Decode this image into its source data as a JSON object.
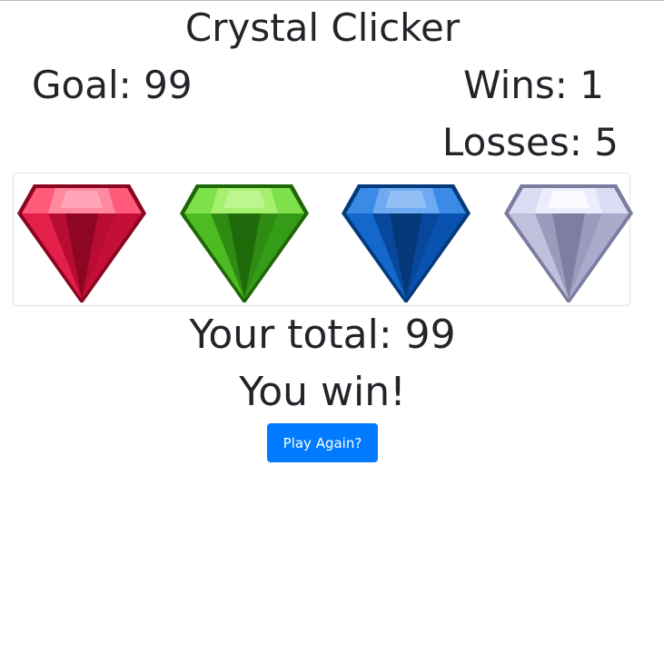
{
  "game": {
    "title": "Crystal Clicker",
    "goal_label": "Goal: ",
    "goal_value": "99",
    "wins_label": "Wins: ",
    "wins_value": "1",
    "losses_label": "Losses: ",
    "losses_value": "5",
    "total_label": "Your total: ",
    "total_value": "99",
    "result_text": "You win!",
    "play_again_label": "Play Again?"
  },
  "crystals": [
    {
      "name": "red-crystal-icon",
      "color": "#d4123a"
    },
    {
      "name": "green-crystal-icon",
      "color": "#3aa81a"
    },
    {
      "name": "blue-crystal-icon",
      "color": "#0a56b8"
    },
    {
      "name": "white-crystal-icon",
      "color": "#a8a8c8"
    }
  ],
  "colors": {
    "button": "#007bff",
    "text": "#212529"
  }
}
